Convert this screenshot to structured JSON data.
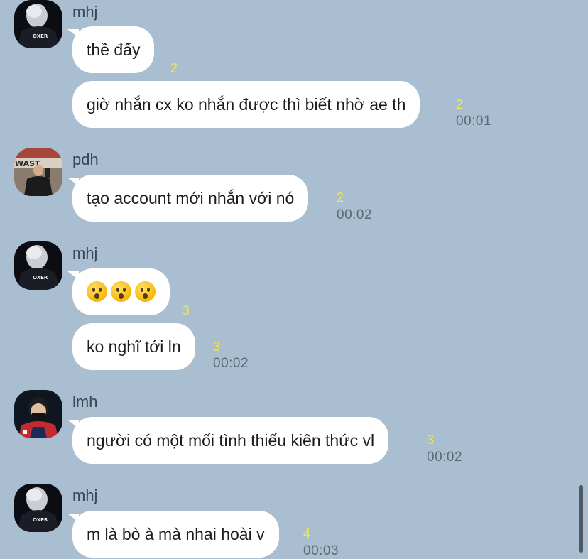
{
  "chat": {
    "messages": [
      {
        "sender": "mhj",
        "text": "thề đấy",
        "read": "2",
        "time": ""
      },
      {
        "sender": "",
        "text": "giờ nhắn cx ko nhắn được thì biết nhờ ae th",
        "read": "2",
        "time": "00:01"
      },
      {
        "sender": "pdh",
        "text": "tạo account mới nhắn với nó",
        "read": "2",
        "time": "00:02"
      },
      {
        "sender": "mhj",
        "emoji": [
          "hushed-face",
          "hushed-face",
          "hushed-face"
        ],
        "read": "3",
        "time": ""
      },
      {
        "sender": "",
        "text": "ko nghĩ tới ln",
        "read": "3",
        "time": "00:02"
      },
      {
        "sender": "lmh",
        "text": "người có một mối tình thiếu kiên thức vl",
        "read": "3",
        "time": "00:02"
      },
      {
        "sender": "mhj",
        "text": "m là bò à mà nhai hoài v",
        "read": "4",
        "time": "00:03"
      }
    ]
  },
  "colors": {
    "background": "#a9bfd1",
    "bubble": "#ffffff",
    "read_count": "#f5e44b",
    "time": "#5c6873"
  }
}
